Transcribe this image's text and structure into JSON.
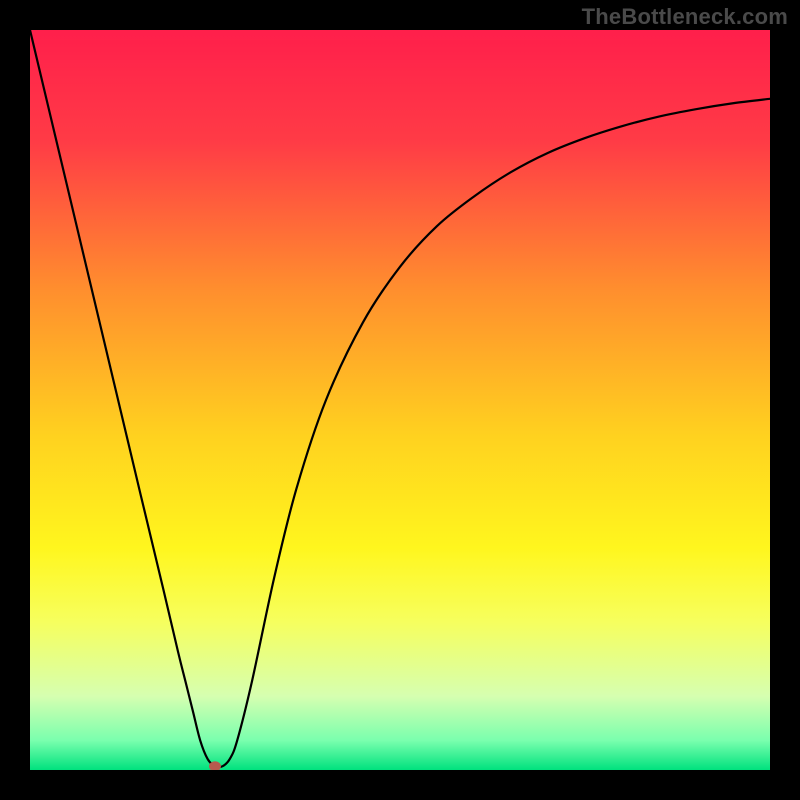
{
  "watermark": "TheBottleneck.com",
  "chart_data": {
    "type": "line",
    "title": "",
    "xlabel": "",
    "ylabel": "",
    "xlim": [
      0,
      100
    ],
    "ylim": [
      0,
      100
    ],
    "grid": false,
    "legend": false,
    "annotations": [],
    "background_gradient": {
      "stops": [
        {
          "offset": 0.0,
          "color": "#ff1f4b"
        },
        {
          "offset": 0.15,
          "color": "#ff3b46"
        },
        {
          "offset": 0.35,
          "color": "#ff8e2e"
        },
        {
          "offset": 0.55,
          "color": "#ffd21f"
        },
        {
          "offset": 0.7,
          "color": "#fff61e"
        },
        {
          "offset": 0.8,
          "color": "#f6ff5e"
        },
        {
          "offset": 0.9,
          "color": "#d6ffb0"
        },
        {
          "offset": 0.96,
          "color": "#7affae"
        },
        {
          "offset": 1.0,
          "color": "#00e27e"
        }
      ]
    },
    "series": [
      {
        "name": "curve",
        "color": "#000000",
        "width": 2.2,
        "x": [
          0,
          5,
          10,
          15,
          18,
          20,
          21,
          22,
          23,
          24,
          25,
          26,
          27,
          28,
          30,
          33,
          36,
          40,
          45,
          50,
          55,
          60,
          65,
          70,
          75,
          80,
          85,
          90,
          95,
          100
        ],
        "y": [
          100,
          79,
          58,
          37,
          24.5,
          16,
          12,
          8,
          4,
          1.5,
          0.5,
          0.5,
          1.5,
          4,
          12,
          26,
          38,
          50,
          60.5,
          68,
          73.5,
          77.5,
          80.8,
          83.4,
          85.4,
          87,
          88.3,
          89.3,
          90.1,
          90.7
        ]
      }
    ],
    "marker": {
      "name": "min-point",
      "x": 25,
      "y": 0.5,
      "color": "#b85a4e",
      "rx": 6,
      "ry": 5
    }
  }
}
